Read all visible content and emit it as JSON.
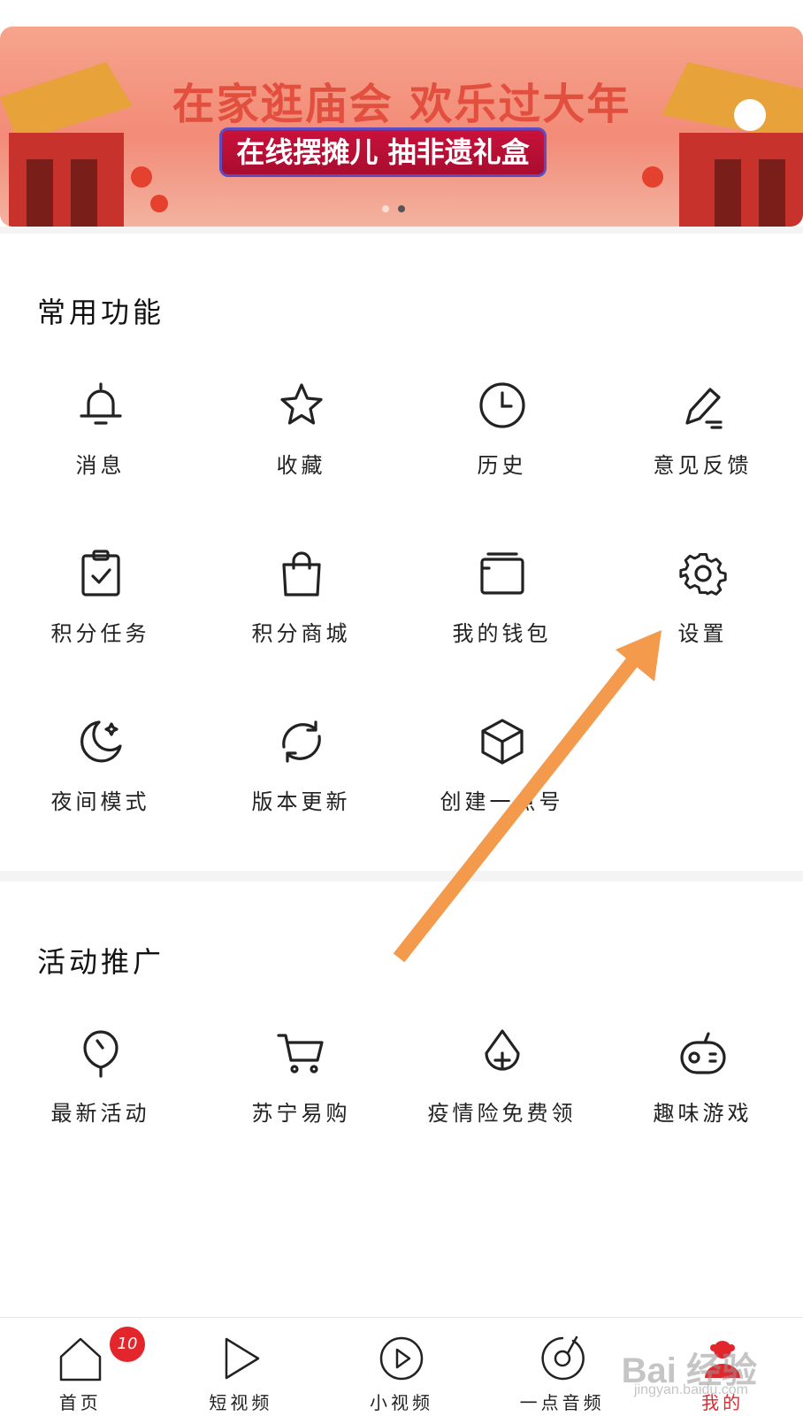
{
  "banner": {
    "title": "在家逛庙会 欢乐过大年",
    "subtitle": "在线摆摊儿 抽非遗礼盒",
    "dots": 2,
    "active_dot": 1
  },
  "common": {
    "title": "常用功能",
    "items": [
      {
        "label": "消息",
        "icon": "bell-icon"
      },
      {
        "label": "收藏",
        "icon": "star-icon"
      },
      {
        "label": "历史",
        "icon": "clock-icon"
      },
      {
        "label": "意见反馈",
        "icon": "pencil-icon"
      },
      {
        "label": "积分任务",
        "icon": "clipboard-check-icon"
      },
      {
        "label": "积分商城",
        "icon": "shopping-bag-icon"
      },
      {
        "label": "我的钱包",
        "icon": "wallet-icon"
      },
      {
        "label": "设置",
        "icon": "gear-icon"
      },
      {
        "label": "夜间模式",
        "icon": "moon-icon"
      },
      {
        "label": "版本更新",
        "icon": "refresh-icon"
      },
      {
        "label": "创建一点号",
        "icon": "cube-icon"
      }
    ]
  },
  "promo": {
    "title": "活动推广",
    "items": [
      {
        "label": "最新活动",
        "icon": "balloon-icon"
      },
      {
        "label": "苏宁易购",
        "icon": "cart-icon"
      },
      {
        "label": "疫情险免费领",
        "icon": "drop-plus-icon"
      },
      {
        "label": "趣味游戏",
        "icon": "gamepad-icon"
      }
    ]
  },
  "tabbar": {
    "items": [
      {
        "label": "首页",
        "icon": "home-icon",
        "badge": "10"
      },
      {
        "label": "短视频",
        "icon": "play-icon"
      },
      {
        "label": "小视频",
        "icon": "play-circle-icon"
      },
      {
        "label": "一点音频",
        "icon": "audio-disc-icon"
      },
      {
        "label": "我的",
        "icon": "profile-icon",
        "active": true
      }
    ]
  },
  "watermark": {
    "text": "Bai 经验",
    "url_text": "jingyan.baidu.com"
  },
  "colors": {
    "accent": "#e2262c",
    "annotation_arrow": "#f39a4c",
    "banner_title": "#e34f3f"
  }
}
